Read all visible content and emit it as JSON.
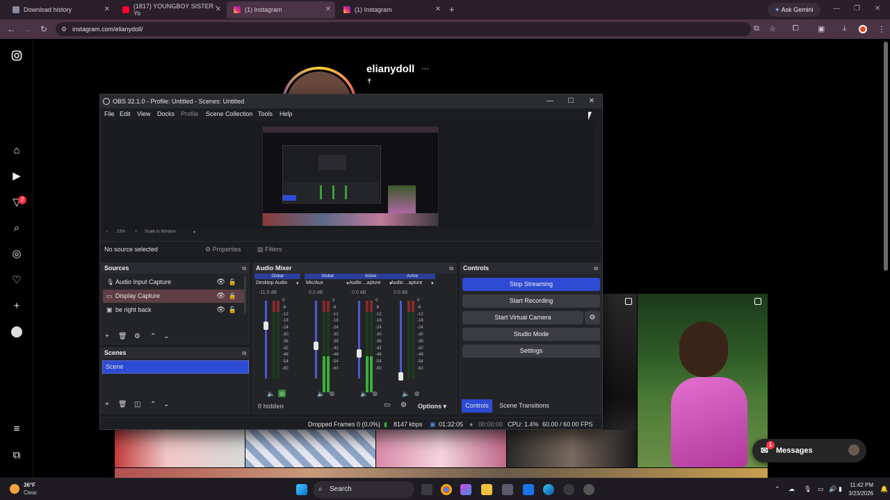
{
  "browser": {
    "tabs": [
      {
        "title": "Download history",
        "active": false
      },
      {
        "title": "(1817) YOUNGBOY SISTER - Yo",
        "active": false
      },
      {
        "title": "(1) Instagram",
        "active": true
      },
      {
        "title": "(1) Instagram",
        "active": false
      }
    ],
    "ask_gemini": "Ask Gemini",
    "url": "instagram.com/elianydoll/"
  },
  "instagram": {
    "username": "elianydoll",
    "more_dots": "···",
    "bio_symbol": "✝",
    "sidebar_icons": [
      "instagram-logo-icon",
      "home-icon",
      "reels-icon",
      "notifications-icon",
      "search-icon",
      "explore-icon",
      "heart-icon",
      "create-icon",
      "profile-icon",
      "menu-icon",
      "apps-icon"
    ],
    "notification_badge": "2",
    "messages": {
      "label": "Messages",
      "badge": "1"
    }
  },
  "obs": {
    "title": "OBS 32.1.0 - Profile: Untitled - Scenes: Untitled",
    "menu": [
      "File",
      "Edit",
      "View",
      "Docks",
      "Profile",
      "Scene Collection",
      "Tools",
      "Help"
    ],
    "zoom": {
      "minus": "−",
      "value": "19%",
      "plus": "+",
      "mode": "Scale to Window"
    },
    "no_source": "No source selected",
    "properties": "Properties",
    "filters": "Filters",
    "sources": {
      "title": "Sources",
      "items": [
        {
          "name": "Audio Input Capture",
          "selected": false
        },
        {
          "name": "Display Capture",
          "selected": true
        },
        {
          "name": "be right back",
          "selected": false
        }
      ]
    },
    "scenes": {
      "title": "Scenes",
      "items": [
        {
          "name": "Scene",
          "selected": true
        }
      ]
    },
    "mixer": {
      "title": "Audio Mixer",
      "channels": [
        {
          "status": "Global",
          "name": "Desktop Audio",
          "db": "-11.0 dB",
          "level": 0.72
        },
        {
          "status": "Global",
          "name": "Mic/Aux",
          "db": "0.0 dB",
          "level": 0.45
        },
        {
          "status": "Active",
          "name": "Audio ...apture",
          "db": "0.0 dB",
          "level": 0.35
        },
        {
          "status": "Active",
          "name": "Audio ...apture",
          "db": "0.0 dB",
          "level": 0.05
        }
      ],
      "scale": [
        "0",
        "-6",
        "-12",
        "-18",
        "-24",
        "-30",
        "-36",
        "-42",
        "-48",
        "-54",
        "-60"
      ],
      "hidden": "0 hidden",
      "options": "Options"
    },
    "controls": {
      "title": "Controls",
      "buttons": [
        "Stop Streaming",
        "Start Recording",
        "Start Virtual Camera",
        "Studio Mode",
        "Settings"
      ],
      "tabs": [
        "Controls",
        "Scene Transitions"
      ]
    },
    "status": {
      "dropped": "Dropped Frames 0 (0.0%)",
      "kbps": "8147 kbps",
      "stream_time": "01:32:05",
      "rec_time": "00:00:00",
      "cpu": "CPU: 1.4%",
      "fps": "60.00 / 60.00 FPS"
    }
  },
  "taskbar": {
    "weather_temp": "36°F",
    "weather_desc": "Clear",
    "search": "Search",
    "time": "11:42 PM",
    "date": "3/23/2026"
  },
  "colors": {
    "obs_accent": "#2e4bd4",
    "selected_source": "#5f3f45",
    "ig_badge": "#ff3040",
    "chrome_toolbar": "#4a3345"
  }
}
